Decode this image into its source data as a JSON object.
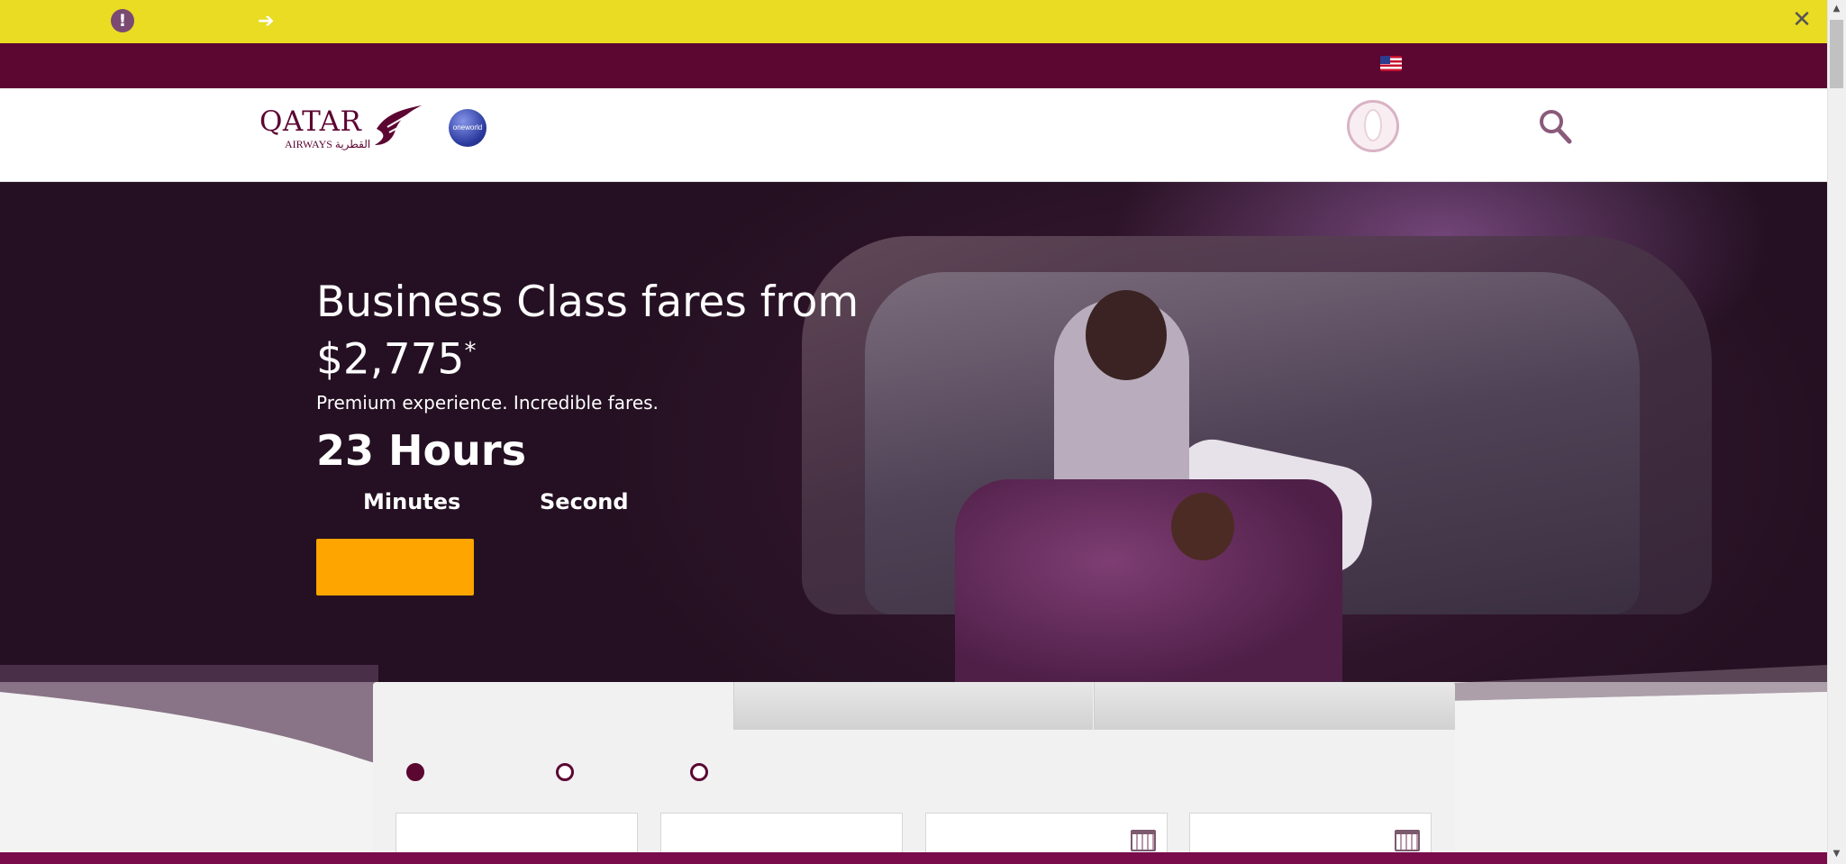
{
  "alert": {
    "icon": "exclamation-icon",
    "icon_glyph": "!",
    "close_glyph": "✕"
  },
  "utility_bar": {
    "arrow_glyph": "➔",
    "flag": "us-flag-icon"
  },
  "header": {
    "logo_word": "QATAR",
    "logo_sub": "AIRWAYS القطرية",
    "oneworld_label": "oneworld"
  },
  "hero": {
    "title": "Business Class fares from $2,775",
    "title_mark": "*",
    "subtitle": "Premium experience. Incredible fares.",
    "hours": "23 Hours",
    "minutes_label": "Minutes",
    "second_label": "Second"
  },
  "colors": {
    "brand": "#5c0632",
    "alert": "#e9dc23",
    "cta": "#ffa500"
  }
}
